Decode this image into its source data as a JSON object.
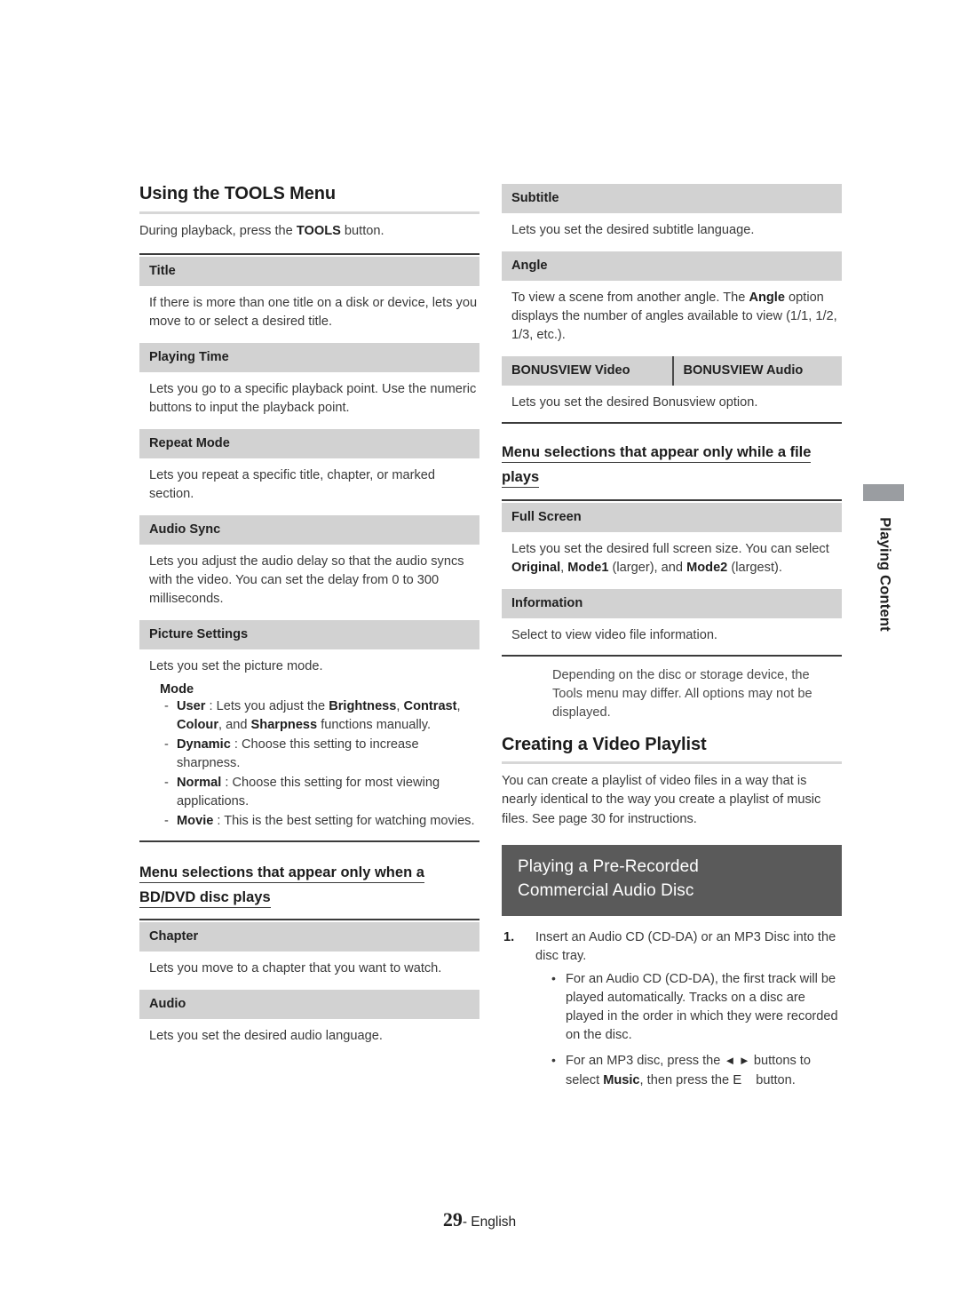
{
  "page": {
    "number": "29",
    "language_label": "- English",
    "side_tab": "Playing Content"
  },
  "left_column": {
    "section_heading": "Using the TOOLS Menu",
    "intro_prefix": "During playback, press the ",
    "intro_bold": "TOOLS",
    "intro_suffix": " button.",
    "options": [
      {
        "header": "Title",
        "body": "If there is more than one title on a disk or device, lets you move to or select a desired title."
      },
      {
        "header": "Playing Time",
        "body": "Lets you go to a specific playback point. Use the numeric buttons to input the playback point."
      },
      {
        "header": "Repeat Mode",
        "body": "Lets you repeat a specific title, chapter, or marked section."
      },
      {
        "header": "Audio Sync",
        "body": "Lets you adjust the audio delay so that the audio syncs with the video. You can set the delay from 0 to 300 milliseconds."
      },
      {
        "header": "Picture Settings",
        "body": "Lets you set the picture mode."
      }
    ],
    "mode_label": "Mode",
    "mode_items": [
      {
        "name": "User",
        "sep": " : ",
        "text_1": "Lets you adjust the ",
        "bold_1": "Brightness",
        "text_2": ", ",
        "bold_2": "Contrast",
        "text_3": ", ",
        "bold_3": "Colour",
        "text_4": ", and ",
        "bold_4": "Sharpness",
        "text_5": " functions manually."
      },
      {
        "name": "Dynamic",
        "sep": " : ",
        "text_1": "Choose this setting to increase sharpness."
      },
      {
        "name": "Normal",
        "sep": " : ",
        "text_1": "Choose this setting for most viewing applications."
      },
      {
        "name": "Movie",
        "sep": " : ",
        "text_1": "This is the best setting for watching movies."
      }
    ],
    "bd_heading_line1": "Menu selections that appear only when a",
    "bd_heading_line2": "BD/DVD disc plays",
    "bd_options": [
      {
        "header": "Chapter",
        "body": "Lets you move to a chapter that you want to watch."
      },
      {
        "header": "Audio",
        "body": "Lets you set the desired audio language."
      }
    ]
  },
  "right_column": {
    "options_continued": [
      {
        "header": "Subtitle",
        "body": "Lets you set the desired subtitle language."
      },
      {
        "header": "Angle",
        "body_1": "To view a scene from another angle. The ",
        "body_bold": "Angle",
        "body_2": " option displays the number of angles available to view (1/1, 1/2, 1/3, etc.)."
      }
    ],
    "bonusview": {
      "header_left": "BONUSVIEW Video",
      "header_right": "BONUSVIEW Audio",
      "body": "Lets you set the desired Bonusview option."
    },
    "file_heading_line1": "Menu selections that appear only while a file",
    "file_heading_line2": "plays",
    "file_options": [
      {
        "header": "Full Screen",
        "body_1": "Lets you set the desired full screen size. You can select ",
        "bold_1": "Original",
        "body_2": ", ",
        "bold_2": "Mode1",
        "body_3": " (larger), and ",
        "bold_3": "Mode2",
        "body_4": " (largest)."
      },
      {
        "header": "Information",
        "body": "Select to view video file information."
      }
    ],
    "note": "Depending on the disc or storage device, the Tools menu may differ. All options may not be displayed.",
    "playlist_heading": "Creating a Video Playlist",
    "playlist_body": "You can create a playlist of video files in a way that is nearly identical to the way you create a playlist of music files. See page 30 for instructions.",
    "dark_heading_line1": "Playing a Pre-Recorded",
    "dark_heading_line2": "Commercial Audio Disc",
    "step1": {
      "number": "1.",
      "text": "Insert an Audio CD (CD-DA) or an MP3 Disc into the disc tray.",
      "bullets": [
        {
          "text": "For an Audio CD (CD-DA), the first track will be played automatically. Tracks on a disc are played in the order in which they were recorded on the disc."
        },
        {
          "text_1": "For an MP3 disc, press the ",
          "arrows": "◄ ►",
          "text_2": " buttons to select ",
          "bold_1": "Music",
          "text_3": ", then press the ",
          "enter_glyph": "E",
          "text_4": "button."
        }
      ]
    }
  },
  "colors": {
    "option_header_bg": "#d2d2d2",
    "dark_box_bg": "#5a5a5a",
    "rule_dark": "#3b3b3b",
    "rule_light": "#d7d7d7",
    "side_tab_bar": "#9a9da1"
  }
}
